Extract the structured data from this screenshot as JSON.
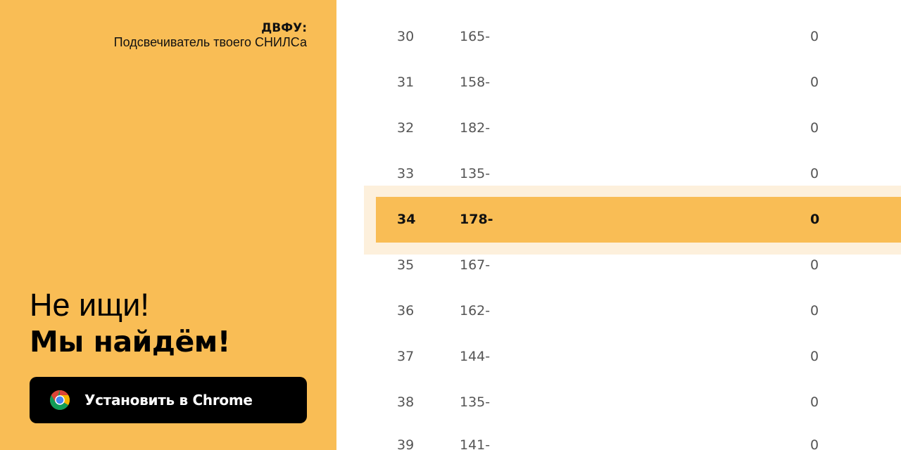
{
  "promo": {
    "brand_title": "ДВФУ:",
    "brand_subtitle": "Подсвечиватель твоего СНИЛСа",
    "headline_line1": "Не ищи!",
    "headline_line2": "Мы найдём!",
    "install_button_label": "Установить в Chrome",
    "install_button_icon": "chrome-icon",
    "accent_color": "#f9bd55"
  },
  "table": {
    "rows": [
      {
        "num": "30",
        "code": "165-",
        "score": "0"
      },
      {
        "num": "31",
        "code": "158-",
        "score": "0"
      },
      {
        "num": "32",
        "code": "182-",
        "score": "0"
      },
      {
        "num": "33",
        "code": "135-",
        "score": "0"
      },
      {
        "num": "34",
        "code": "178-",
        "score": "0",
        "highlighted": true
      },
      {
        "num": "35",
        "code": "167-",
        "score": "0"
      },
      {
        "num": "36",
        "code": "162-",
        "score": "0"
      },
      {
        "num": "37",
        "code": "144-",
        "score": "0"
      },
      {
        "num": "38",
        "code": "135-",
        "score": "0"
      },
      {
        "num": "39",
        "code": "141-",
        "score": "0"
      }
    ]
  }
}
